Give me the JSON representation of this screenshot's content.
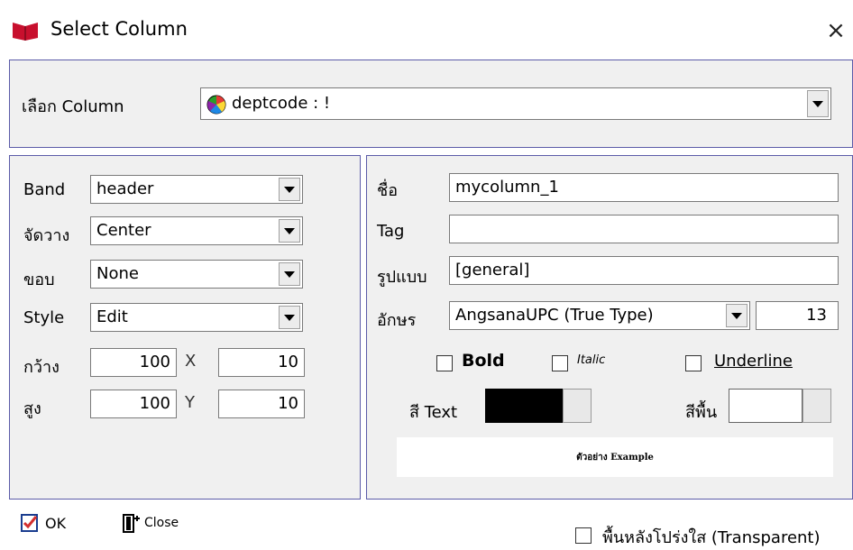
{
  "dialog": {
    "title": "Select Column",
    "close_symbol": "×"
  },
  "column_select": {
    "label": "เลือก Column",
    "value": "deptcode : !"
  },
  "left": {
    "band": {
      "label": "Band",
      "value": "header"
    },
    "align": {
      "label": "จัดวาง",
      "value": "Center"
    },
    "border": {
      "label": "ขอบ",
      "value": "None"
    },
    "style": {
      "label": "Style",
      "value": "Edit"
    },
    "width": {
      "label": "กว้าง",
      "value": "100",
      "coord_label": "X",
      "coord_value": "10"
    },
    "height": {
      "label": "สูง",
      "value": "100",
      "coord_label": "Y",
      "coord_value": "10"
    }
  },
  "right": {
    "name": {
      "label": "ชื่อ",
      "value": "mycolumn_1"
    },
    "tag": {
      "label": "Tag",
      "value": ""
    },
    "format": {
      "label": "รูปแบบ",
      "value": "[general]"
    },
    "font": {
      "label": "อักษร",
      "value": "AngsanaUPC (True Type)",
      "size": "13"
    },
    "bold": {
      "label": "Bold",
      "checked": false
    },
    "italic": {
      "label": "Italic",
      "checked": false
    },
    "underline": {
      "label": "Underline",
      "checked": false
    },
    "text_color": {
      "label": "สี Text",
      "color": "#000000"
    },
    "bg_color": {
      "label": "สีพื้น",
      "color": "#ffffff"
    },
    "preview_text": "ตัวอย่าง Example"
  },
  "footer": {
    "ok_label": "OK",
    "close_label": "Close",
    "transparent_label": "พื้นหลังโปร่งใส (Transparent)",
    "transparent_checked": false
  },
  "colors": {
    "panel_border": "#5b5ba8",
    "panel_bg": "#f0f0f0"
  }
}
